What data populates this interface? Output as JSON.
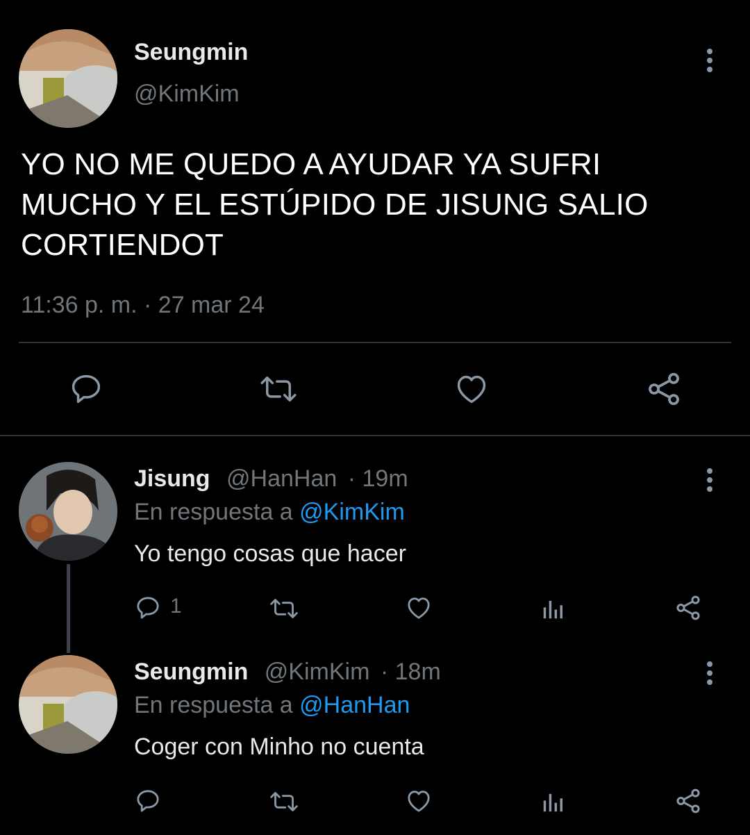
{
  "main_tweet": {
    "author_name": "Seungmin",
    "author_handle": "@KimKim",
    "text": "YO NO ME QUEDO A AYUDAR YA SUFRI MUCHO Y EL ESTÚPIDO DE JISUNG SALIO CORTIENDOT",
    "timestamp": "11:36 p. m. · 27 mar 24",
    "avatar_icon": "profile-photo",
    "actions": [
      "reply-icon",
      "retweet-icon",
      "like-icon",
      "share-icon"
    ]
  },
  "replies": [
    {
      "author_name": "Jisung",
      "author_handle": "@HanHan",
      "time": "· 19m",
      "reply_prefix": "En respuesta a ",
      "reply_to": "@KimKim",
      "text": "Yo tengo cosas que hacer",
      "reply_count": "1",
      "avatar_icon": "profile-photo"
    },
    {
      "author_name": "Seungmin",
      "author_handle": "@KimKim",
      "time": "· 18m",
      "reply_prefix": "En respuesta a ",
      "reply_to": "@HanHan",
      "text": "Coger con Minho no cuenta",
      "reply_count": "",
      "avatar_icon": "profile-photo"
    }
  ],
  "colors": {
    "background": "#000000",
    "text_primary": "#e7e9ea",
    "text_secondary": "#71767b",
    "link": "#1d9bf0",
    "icon": "#8b98a5",
    "divider": "#2f3336"
  }
}
